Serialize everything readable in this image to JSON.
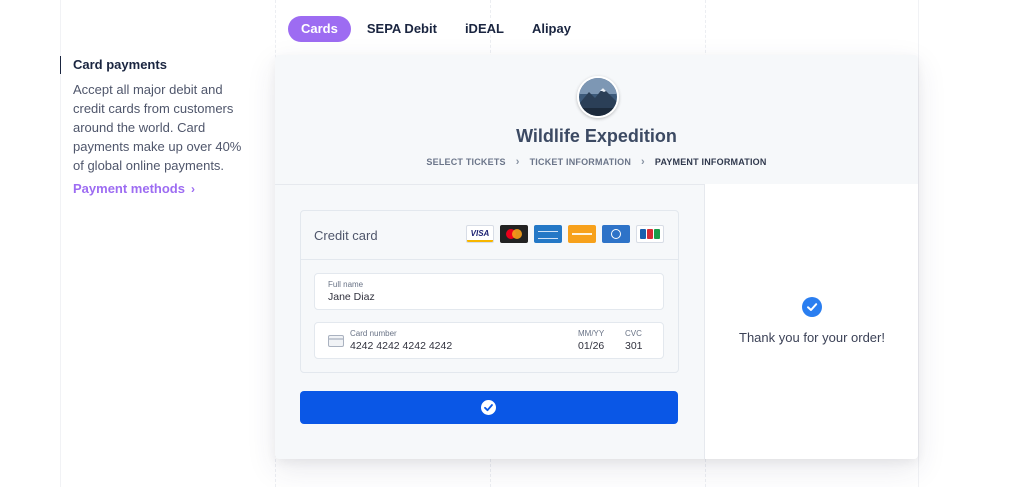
{
  "tabs": [
    {
      "label": "Cards",
      "active": true
    },
    {
      "label": "SEPA Debit",
      "active": false
    },
    {
      "label": "iDEAL",
      "active": false
    },
    {
      "label": "Alipay",
      "active": false
    }
  ],
  "sidebar": {
    "title": "Card payments",
    "description": "Accept all major debit and credit cards from customers around the world. Card payments make up over 40% of global online payments.",
    "link_label": "Payment methods",
    "link_chevron": "›"
  },
  "checkout": {
    "title": "Wildlife Expedition",
    "steps": [
      "SELECT TICKETS",
      "TICKET INFORMATION",
      "PAYMENT INFORMATION"
    ],
    "step_separator": "›",
    "payment_method_label": "Credit card",
    "card_brands": [
      "visa",
      "mastercard",
      "amex",
      "discover",
      "diners",
      "jcb"
    ],
    "visa_text": "VISA",
    "full_name_label": "Full name",
    "full_name_value": "Jane Diaz",
    "card_number_label": "Card number",
    "card_number_value": "4242 4242 4242 4242",
    "expiry_label": "MM/YY",
    "expiry_value": "01/26",
    "cvc_label": "CVC",
    "cvc_value": "301",
    "confirmation_text": "Thank you for your order!"
  },
  "colors": {
    "accent_purple": "#9d6cf2",
    "pay_button": "#0a57e6",
    "success_blue": "#2a7ef0"
  }
}
